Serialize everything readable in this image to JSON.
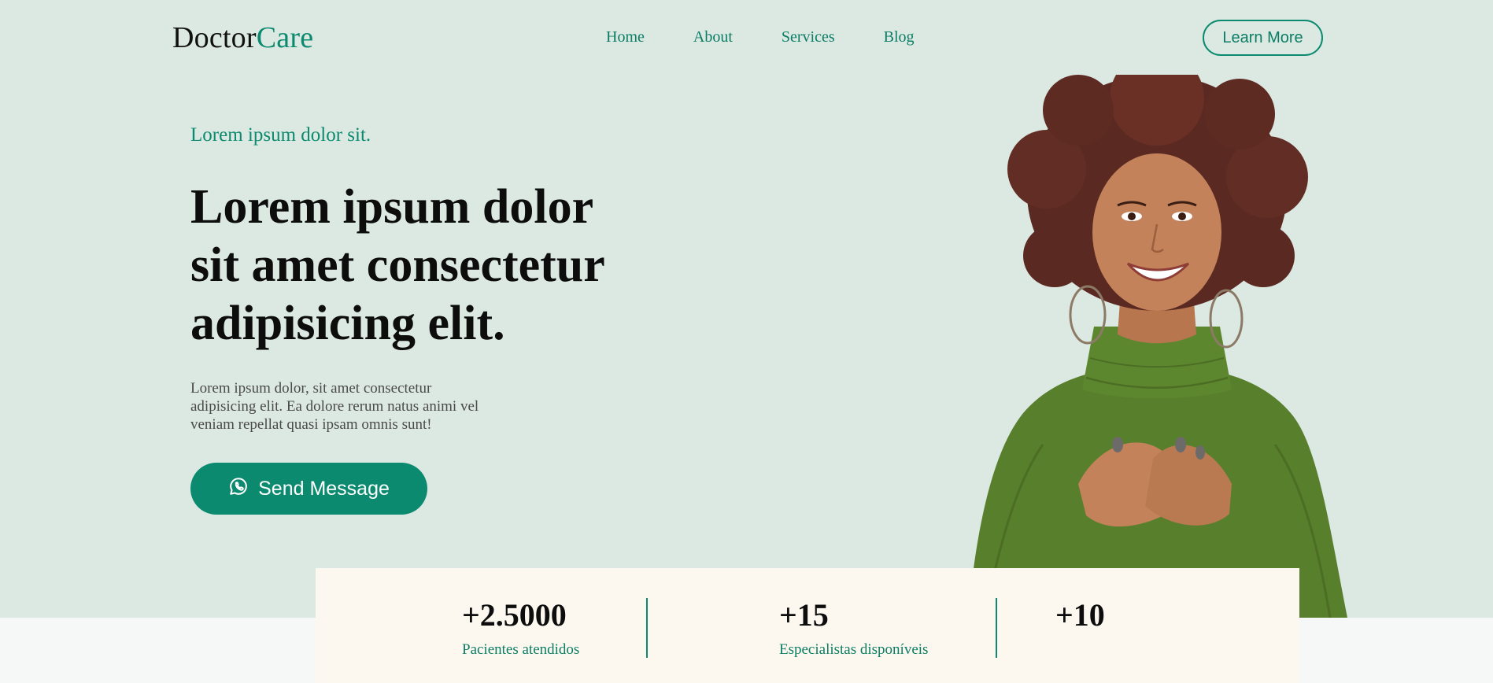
{
  "brand": {
    "name_part1": "Doctor",
    "name_part2": "Care"
  },
  "nav": {
    "items": [
      "Home",
      "About",
      "Services",
      "Blog"
    ]
  },
  "header": {
    "cta_label": "Learn More"
  },
  "hero": {
    "eyebrow": "Lorem ipsum dolor sit.",
    "headline_line1": "Lorem ipsum dolor",
    "headline_line2": "sit amet consectetur",
    "headline_line3": "adipisicing elit.",
    "description": "Lorem ipsum dolor, sit amet consectetur adipisicing elit. Ea dolore rerum natus animi vel veniam repellat quasi ipsam omnis sunt!",
    "send_label": "Send Message",
    "send_icon": "whatsapp-icon"
  },
  "stats": [
    {
      "value": "+2.5000",
      "label": "Pacientes atendidos"
    },
    {
      "value": "+15",
      "label": "Especialistas disponíveis"
    },
    {
      "value": "+10",
      "label": ""
    }
  ],
  "colors": {
    "accent": "#0b8a6f",
    "hero_bg": "#dce9e2",
    "stats_bg": "#fdf8ef",
    "page_bg": "#f6f8f7"
  }
}
